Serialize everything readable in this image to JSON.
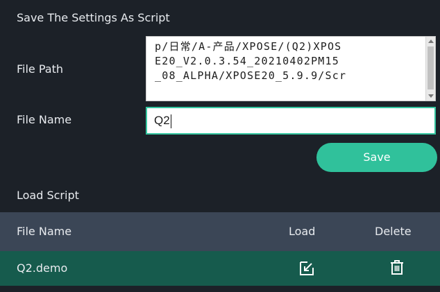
{
  "save_section": {
    "title": "Save The Settings As Script",
    "file_path_label": "File Path",
    "file_path_lines": [
      "p/日常/A-产品/XPOSE/(Q2)XPOS",
      "E20_V2.0.3.54_20210402PM15",
      "_08_ALPHA/XPOSE20_5.9.9/Scr"
    ],
    "file_name_label": "File Name",
    "file_name_value": "Q2",
    "save_label": "Save"
  },
  "load_section": {
    "title": "Load Script",
    "columns": {
      "file_name": "File Name",
      "load": "Load",
      "delete": "Delete"
    },
    "rows": [
      {
        "file_name": "Q2.demo",
        "load_icon": "load-icon",
        "delete_icon": "trash-icon"
      }
    ]
  },
  "colors": {
    "background": "#1c2128",
    "accent": "#30c19b",
    "header_row": "#3b4656",
    "selected_row": "#165b4d"
  }
}
